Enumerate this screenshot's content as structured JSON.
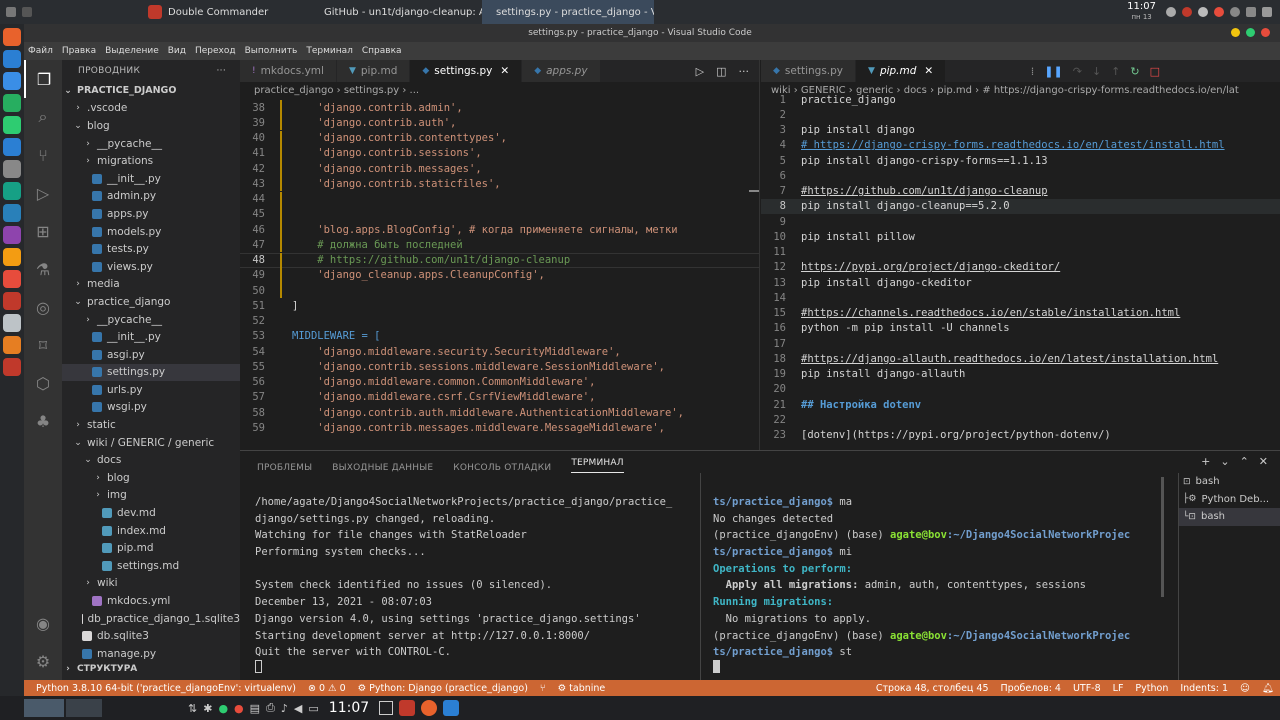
{
  "os_tabs": [
    {
      "label": "Double Commander",
      "color": "#c0392b"
    },
    {
      "label": "GitHub - un1t/django-cleanup: Aut...",
      "color": "#e8622c"
    },
    {
      "label": "settings.py - practice_django - Visu...",
      "color": "#2b7fd3"
    }
  ],
  "clock": {
    "time": "11:07",
    "day": "пн 13"
  },
  "window_title": "settings.py - practice_django - Visual Studio Code",
  "menu": [
    "Файл",
    "Правка",
    "Выделение",
    "Вид",
    "Переход",
    "Выполнить",
    "Терминал",
    "Справка"
  ],
  "explorer": {
    "header": "ПРОВОДНИК",
    "root": "PRACTICE_DJANGO",
    "outline": "СТРУКТУРА",
    "items": [
      {
        "label": ".vscode",
        "indent": 1,
        "type": "folder",
        "open": false
      },
      {
        "label": "blog",
        "indent": 1,
        "type": "folder",
        "open": true
      },
      {
        "label": "__pycache__",
        "indent": 2,
        "type": "folder",
        "open": false
      },
      {
        "label": "migrations",
        "indent": 2,
        "type": "folder",
        "open": false
      },
      {
        "label": "__init__.py",
        "indent": 2,
        "type": "py"
      },
      {
        "label": "admin.py",
        "indent": 2,
        "type": "py"
      },
      {
        "label": "apps.py",
        "indent": 2,
        "type": "py"
      },
      {
        "label": "models.py",
        "indent": 2,
        "type": "py"
      },
      {
        "label": "tests.py",
        "indent": 2,
        "type": "py"
      },
      {
        "label": "views.py",
        "indent": 2,
        "type": "py"
      },
      {
        "label": "media",
        "indent": 1,
        "type": "folder",
        "open": false
      },
      {
        "label": "practice_django",
        "indent": 1,
        "type": "folder",
        "open": true
      },
      {
        "label": "__pycache__",
        "indent": 2,
        "type": "folder",
        "open": false
      },
      {
        "label": "__init__.py",
        "indent": 2,
        "type": "py"
      },
      {
        "label": "asgi.py",
        "indent": 2,
        "type": "py"
      },
      {
        "label": "settings.py",
        "indent": 2,
        "type": "py",
        "selected": true
      },
      {
        "label": "urls.py",
        "indent": 2,
        "type": "py"
      },
      {
        "label": "wsgi.py",
        "indent": 2,
        "type": "py"
      },
      {
        "label": "static",
        "indent": 1,
        "type": "folder",
        "open": false
      },
      {
        "label": "wiki / GENERIC / generic",
        "indent": 1,
        "type": "folder",
        "open": true
      },
      {
        "label": "docs",
        "indent": 2,
        "type": "folder",
        "open": true
      },
      {
        "label": "blog",
        "indent": 3,
        "type": "folder",
        "open": false
      },
      {
        "label": "img",
        "indent": 3,
        "type": "folder",
        "open": false
      },
      {
        "label": "dev.md",
        "indent": 3,
        "type": "md"
      },
      {
        "label": "index.md",
        "indent": 3,
        "type": "md"
      },
      {
        "label": "pip.md",
        "indent": 3,
        "type": "md"
      },
      {
        "label": "settings.md",
        "indent": 3,
        "type": "md"
      },
      {
        "label": "wiki",
        "indent": 2,
        "type": "folder",
        "open": false
      },
      {
        "label": "mkdocs.yml",
        "indent": 2,
        "type": "yml"
      },
      {
        "label": "db_practice_django_1.sqlite3",
        "indent": 1,
        "type": "db"
      },
      {
        "label": "db.sqlite3",
        "indent": 1,
        "type": "db"
      },
      {
        "label": "manage.py",
        "indent": 1,
        "type": "py"
      }
    ]
  },
  "left_tabs": [
    {
      "label": "mkdocs.yml"
    },
    {
      "label": "pip.md"
    },
    {
      "label": "settings.py",
      "active": true
    },
    {
      "label": "apps.py",
      "italic": true
    }
  ],
  "left_breadcrumb": "practice_django  ›  settings.py  ›  ...",
  "left_code": [
    {
      "n": "38",
      "t": "    'django.contrib.admin',"
    },
    {
      "n": "39",
      "t": "    'django.contrib.auth',"
    },
    {
      "n": "40",
      "t": "    'django.contrib.contenttypes',"
    },
    {
      "n": "41",
      "t": "    'django.contrib.sessions',"
    },
    {
      "n": "42",
      "t": "    'django.contrib.messages',"
    },
    {
      "n": "43",
      "t": "    'django.contrib.staticfiles',"
    },
    {
      "n": "44",
      "t": ""
    },
    {
      "n": "45",
      "t": ""
    },
    {
      "n": "46",
      "t": "    'blog.apps.BlogConfig', # когда применяете сигналы, метки"
    },
    {
      "n": "47",
      "t": "    # должна быть последней"
    },
    {
      "n": "48",
      "t": "    # https://github.com/un1t/django-cleanup",
      "cur": true
    },
    {
      "n": "49",
      "t": "    'django_cleanup.apps.CleanupConfig',"
    },
    {
      "n": "50",
      "t": ""
    },
    {
      "n": "51",
      "t": "]"
    },
    {
      "n": "52",
      "t": ""
    },
    {
      "n": "53",
      "t": "MIDDLEWARE = ["
    },
    {
      "n": "54",
      "t": "    'django.middleware.security.SecurityMiddleware',"
    },
    {
      "n": "55",
      "t": "    'django.contrib.sessions.middleware.SessionMiddleware',"
    },
    {
      "n": "56",
      "t": "    'django.middleware.common.CommonMiddleware',"
    },
    {
      "n": "57",
      "t": "    'django.middleware.csrf.CsrfViewMiddleware',"
    },
    {
      "n": "58",
      "t": "    'django.contrib.auth.middleware.AuthenticationMiddleware',"
    },
    {
      "n": "59",
      "t": "    'django.contrib.messages.middleware.MessageMiddleware',"
    }
  ],
  "right_tabs": [
    {
      "label": "settings.py"
    },
    {
      "label": "pip.md",
      "active": true,
      "italic": true
    }
  ],
  "right_breadcrumb": "wiki › GENERIC › generic › docs › pip.md › # https://django-crispy-forms.readthedocs.io/en/lat",
  "right_code": [
    {
      "n": "1",
      "t": "practice_django"
    },
    {
      "n": "2",
      "t": ""
    },
    {
      "n": "3",
      "t": "pip install django"
    },
    {
      "n": "4",
      "t": "# https://django-crispy-forms.readthedocs.io/en/latest/install.html",
      "link": true
    },
    {
      "n": "5",
      "t": "pip install django-crispy-forms==1.1.13"
    },
    {
      "n": "6",
      "t": ""
    },
    {
      "n": "7",
      "t": "#https://github.com/un1t/django-cleanup",
      "link": true
    },
    {
      "n": "8",
      "t": "pip install django-cleanup==5.2.0",
      "cur": true
    },
    {
      "n": "9",
      "t": ""
    },
    {
      "n": "10",
      "t": "pip install pillow"
    },
    {
      "n": "11",
      "t": ""
    },
    {
      "n": "12",
      "t": "https://pypi.org/project/django-ckeditor/",
      "link": true
    },
    {
      "n": "13",
      "t": "pip install django-ckeditor"
    },
    {
      "n": "14",
      "t": ""
    },
    {
      "n": "15",
      "t": "#https://channels.readthedocs.io/en/stable/installation.html",
      "link": true
    },
    {
      "n": "16",
      "t": "python -m pip install -U channels"
    },
    {
      "n": "17",
      "t": ""
    },
    {
      "n": "18",
      "t": "#https://django-allauth.readthedocs.io/en/latest/installation.html",
      "link": true
    },
    {
      "n": "19",
      "t": "pip install django-allauth"
    },
    {
      "n": "20",
      "t": ""
    },
    {
      "n": "21",
      "t": "## Настройка dotenv",
      "heading": true
    },
    {
      "n": "22",
      "t": ""
    },
    {
      "n": "23",
      "t": "[dotenv](https://pypi.org/project/python-dotenv/)"
    }
  ],
  "panel_tabs": [
    "ПРОБЛЕМЫ",
    "ВЫХОДНЫЕ ДАННЫЕ",
    "КОНСОЛЬ ОТЛАДКИ",
    "ТЕРМИНАЛ"
  ],
  "term_left": [
    "",
    "/home/agate/Django4SocialNetworkProjects/practice_django/practice_",
    "django/settings.py changed, reloading.",
    "Watching for file changes with StatReloader",
    "Performing system checks...",
    "",
    "System check identified no issues (0 silenced).",
    "December 13, 2021 - 08:07:03",
    "Django version 4.0, using settings 'practice_django.settings'",
    "Starting development server at http://127.0.0.1:8000/",
    "Quit the server with CONTROL-C.",
    ""
  ],
  "term_right": [
    {
      "t": ""
    },
    {
      "t": "ts/practice_django$ ma"
    },
    {
      "t": "No changes detected"
    },
    {
      "t": "(practice_djangoEnv) (base) ",
      "u": "agate@bov",
      "p": ":~/Django4SocialNetworkProjec"
    },
    {
      "t": "ts/practice_django$ mi"
    },
    {
      "t": "Operations to perform:",
      "c": "#3fb6c6",
      "b": true
    },
    {
      "t": "  Apply all migrations:",
      "b": true,
      "rest": " admin, auth, contenttypes, sessions"
    },
    {
      "t": "Running migrations:",
      "c": "#3fb6c6",
      "b": true
    },
    {
      "t": "  No migrations to apply."
    },
    {
      "t": "(practice_djangoEnv) (base) ",
      "u": "agate@bov",
      "p": ":~/Django4SocialNetworkProjec"
    },
    {
      "t": "ts/practice_django$ st"
    },
    {
      "t": ""
    }
  ],
  "term_list": [
    {
      "label": "bash"
    },
    {
      "label": "Python Deb..."
    },
    {
      "label": "bash",
      "active": true
    }
  ],
  "status": {
    "interpreter": "Python 3.8.10 64-bit ('practice_djangoEnv': virtualenv)",
    "problems": "⊗ 0 ⚠ 0",
    "run": "⚙ Python: Django (practice_django)",
    "tabnine": "⚙ tabnine",
    "position": "Строка 48, столбец 45",
    "spaces": "Пробелов: 4",
    "encoding": "UTF-8",
    "eol": "LF",
    "lang": "Python",
    "indents": "Indents: 1"
  },
  "taskbar": {
    "time": "11:07"
  },
  "colors": {
    "keyword": "#569cd6",
    "string": "#ce9178",
    "comment": "#6a9955",
    "link": "#4fc1ff",
    "accent": "#cc6633"
  }
}
